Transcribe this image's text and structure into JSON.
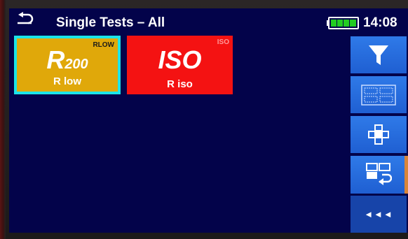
{
  "header": {
    "title": "Single Tests – All",
    "time": "14:08",
    "back_icon": "back-arrow-icon",
    "battery_icon": "battery-full-icon"
  },
  "tiles": [
    {
      "tag": "RLOW",
      "symbol": "R",
      "symbol_sub": "200",
      "label": "R low",
      "color": "#e0a80a",
      "selected": true
    },
    {
      "tag": "ISO",
      "symbol": "ISO",
      "label": "R iso",
      "color": "#f41212",
      "selected": false
    }
  ],
  "sidebar": {
    "buttons": [
      {
        "icon": "filter-icon"
      },
      {
        "icon": "grid-view-icon"
      },
      {
        "icon": "cross-layout-icon"
      },
      {
        "icon": "recall-return-icon"
      }
    ],
    "nav": {
      "label": "◄◄◄",
      "icon": "triple-left-arrow-icon"
    }
  },
  "colors": {
    "screen_bg": "#03034a",
    "accent_blue": "#2f7ae8",
    "selected_border": "#1ce4e8"
  }
}
